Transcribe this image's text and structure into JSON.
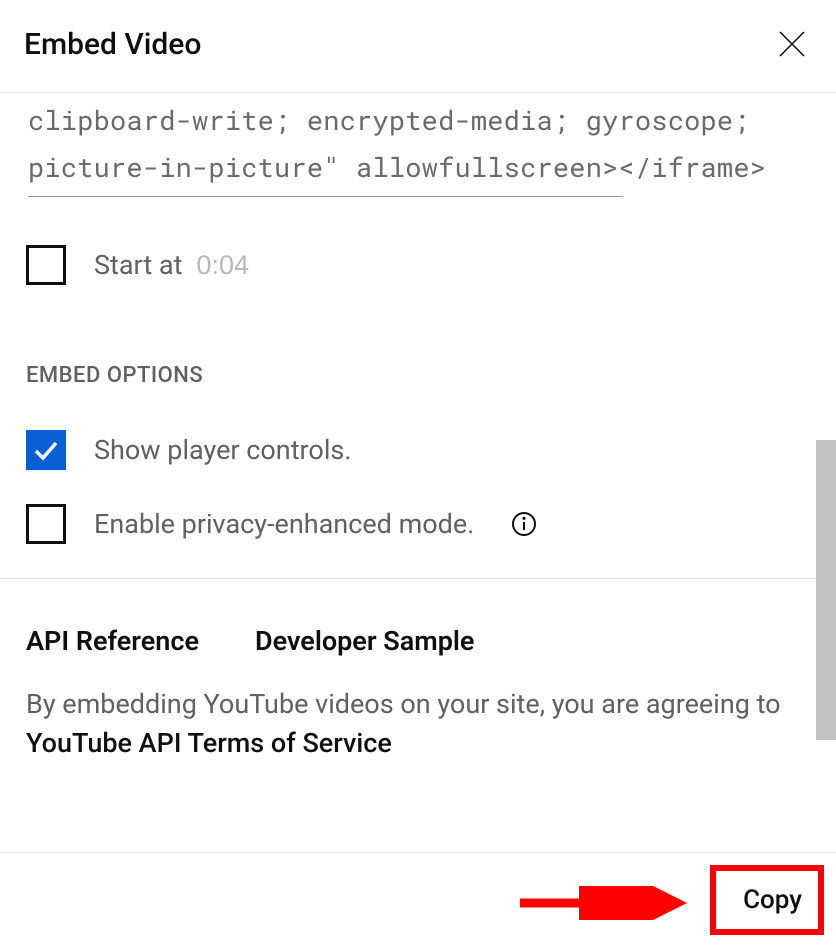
{
  "header": {
    "title": "Embed Video"
  },
  "embed_code": "clipboard-write; encrypted-media; gyroscope; picture-in-picture\" allowfullscreen></iframe>",
  "start_at": {
    "label": "Start at",
    "time": "0:04",
    "checked": false
  },
  "options": {
    "heading": "EMBED OPTIONS",
    "show_controls": {
      "label": "Show player controls.",
      "checked": true
    },
    "privacy_mode": {
      "label": "Enable privacy-enhanced mode.",
      "checked": false
    }
  },
  "links": {
    "api_ref": "API Reference",
    "dev_sample": "Developer Sample"
  },
  "terms": {
    "prefix": "By embedding YouTube videos on your site, you are agreeing to ",
    "link": "YouTube API Terms of Service"
  },
  "footer": {
    "copy_label": "Copy"
  }
}
